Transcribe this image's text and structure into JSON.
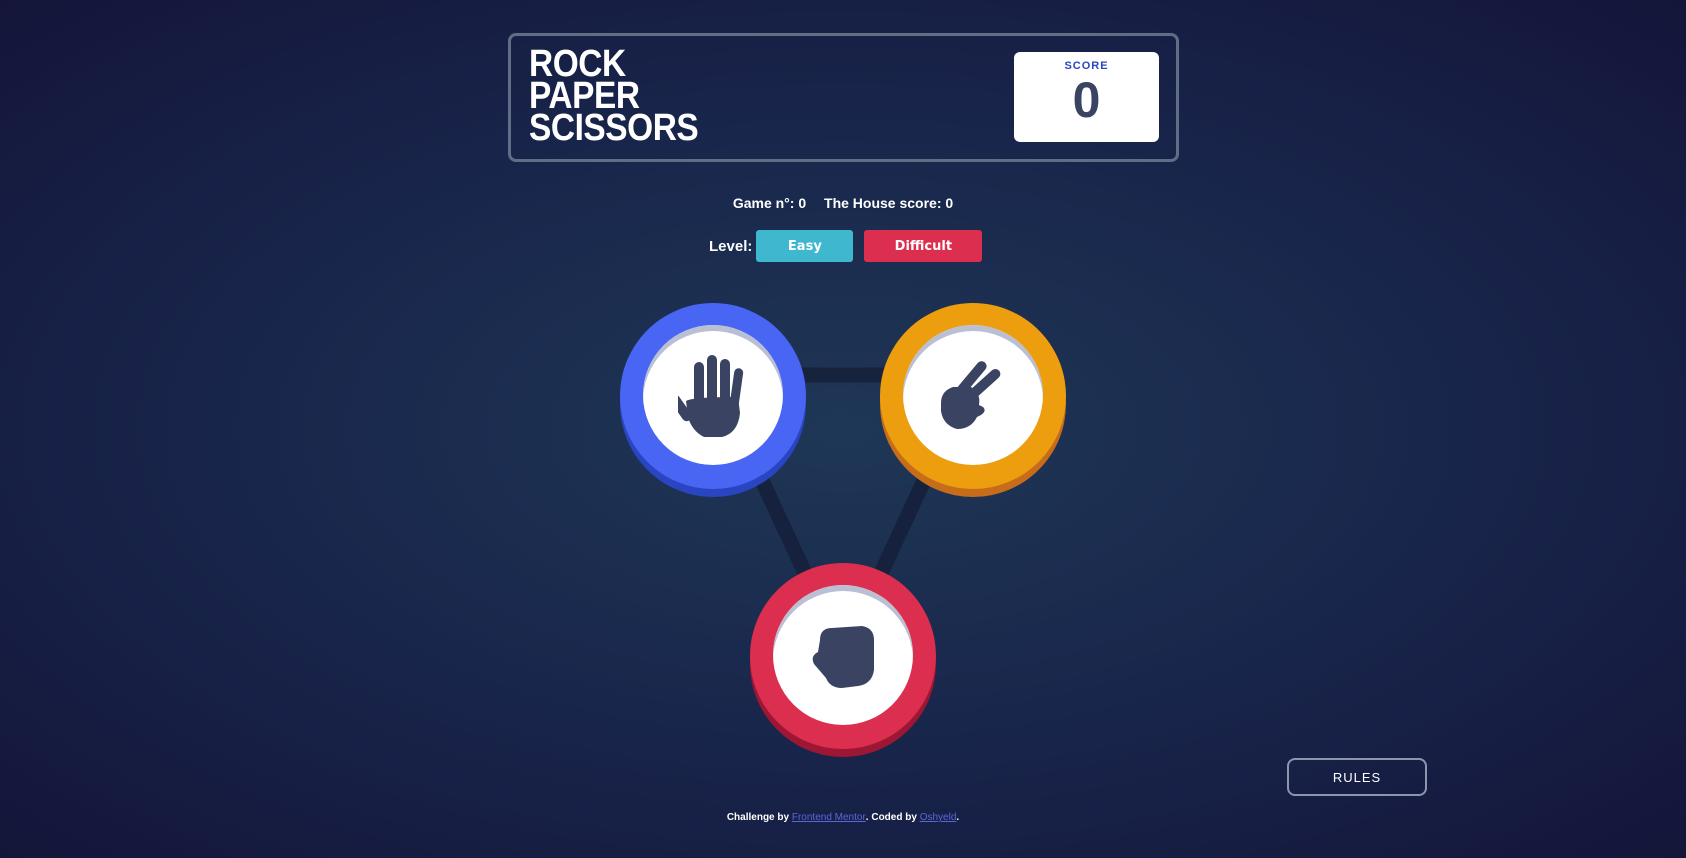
{
  "header": {
    "title_lines": [
      "ROCK",
      "PAPER",
      "SCISSORS"
    ],
    "score_label": "SCORE",
    "score_value": "0"
  },
  "stats": {
    "game_number": "Game n°: 0",
    "house_score": "The House score: 0"
  },
  "level": {
    "label": "Level:",
    "options": [
      "Easy",
      "Difficult"
    ]
  },
  "tokens": [
    {
      "name": "paper",
      "icon": "hand-paper-icon",
      "color": "#4865f4"
    },
    {
      "name": "scissors",
      "icon": "hand-scissors-icon",
      "color": "#ec9e0e"
    },
    {
      "name": "rock",
      "icon": "hand-rock-icon",
      "color": "#dc2e4e"
    }
  ],
  "rules_button": "RULES",
  "footer": {
    "prefix": "Challenge by",
    "link1": "Frontend Mentor",
    "middle": ". Coded by",
    "link2": "Oshyeld",
    "suffix": "."
  },
  "colors": {
    "background": "#1f3756",
    "header_border": "#606e85",
    "score_label": "#2a46c0",
    "dark_text": "#3b4363",
    "easy_button": "#3fb7cf",
    "difficult_button": "#dc2e4e"
  }
}
